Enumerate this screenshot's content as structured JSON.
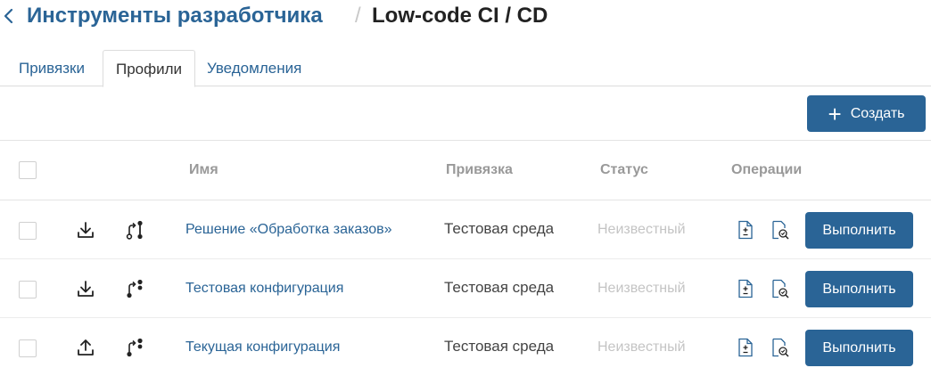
{
  "breadcrumb": {
    "parent": "Инструменты разработчика",
    "separator": "/",
    "current": "Low-code CI / CD"
  },
  "tabs": [
    {
      "label": "Привязки",
      "active": false
    },
    {
      "label": "Профили",
      "active": true
    },
    {
      "label": "Уведомления",
      "active": false
    }
  ],
  "toolbar": {
    "create_label": "Создать",
    "create_icon": "plus-icon"
  },
  "table": {
    "columns": {
      "name": "Имя",
      "binding": "Привязка",
      "status": "Статус",
      "operations": "Операции"
    },
    "rows": [
      {
        "direction_icon": "download-icon",
        "name": "Решение «Обработка заказов»",
        "binding": "Тестовая среда",
        "status": "Неизвестный",
        "run_label": "Выполнить"
      },
      {
        "direction_icon": "download-icon",
        "name": "Тестовая конфигурация",
        "binding": "Тестовая среда",
        "status": "Неизвестный",
        "run_label": "Выполнить"
      },
      {
        "direction_icon": "upload-icon",
        "name": "Текущая конфигурация",
        "binding": "Тестовая среда",
        "status": "Неизвестный",
        "run_label": "Выполнить"
      }
    ]
  },
  "colors": {
    "accent": "#2a6496",
    "status_unknown": "#c4c4c4",
    "header_text": "#999999"
  }
}
